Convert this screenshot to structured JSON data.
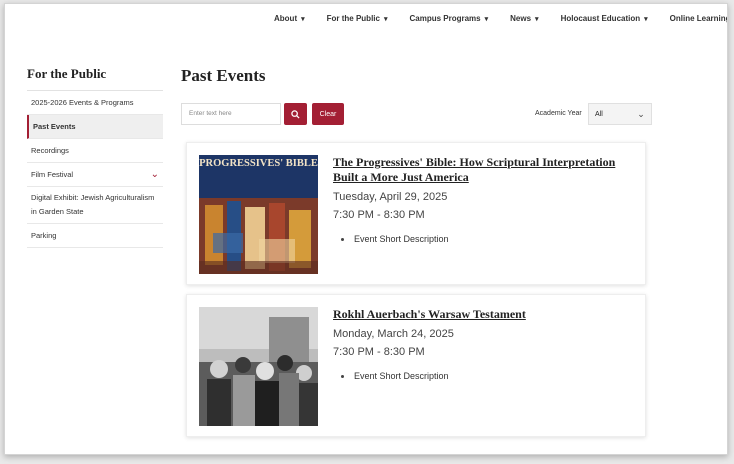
{
  "topnav": [
    {
      "label": "About"
    },
    {
      "label": "For the Public"
    },
    {
      "label": "Campus Programs"
    },
    {
      "label": "News"
    },
    {
      "label": "Holocaust Education"
    },
    {
      "label": "Online Learning"
    }
  ],
  "sidebar": {
    "title": "For the Public",
    "items": [
      {
        "label": "2025-2026 Events & Programs"
      },
      {
        "label": "Past Events"
      },
      {
        "label": "Recordings"
      },
      {
        "label": "Film Festival"
      },
      {
        "label": "Digital Exhibit: Jewish Agriculturalism in Garden State"
      },
      {
        "label": "Parking"
      }
    ]
  },
  "main": {
    "title": "Past Events",
    "search_placeholder": "Enter text here",
    "clear_label": "Clear",
    "year_label": "Academic Year",
    "year_value": "All"
  },
  "events": [
    {
      "title": "The Progressives' Bible: How Scriptural Interpretation Built a More Just America",
      "date": "Tuesday, April 29, 2025",
      "time": "7:30 PM - 8:30 PM",
      "description": "Event Short Description",
      "cover_text": "PROGRESSIVES' BIBLE"
    },
    {
      "title": "Rokhl Auerbach's Warsaw Testament",
      "date": "Monday, March 24, 2025",
      "time": "7:30 PM - 8:30 PM",
      "description": "Event Short Description"
    }
  ],
  "colors": {
    "accent": "#a31f34"
  }
}
